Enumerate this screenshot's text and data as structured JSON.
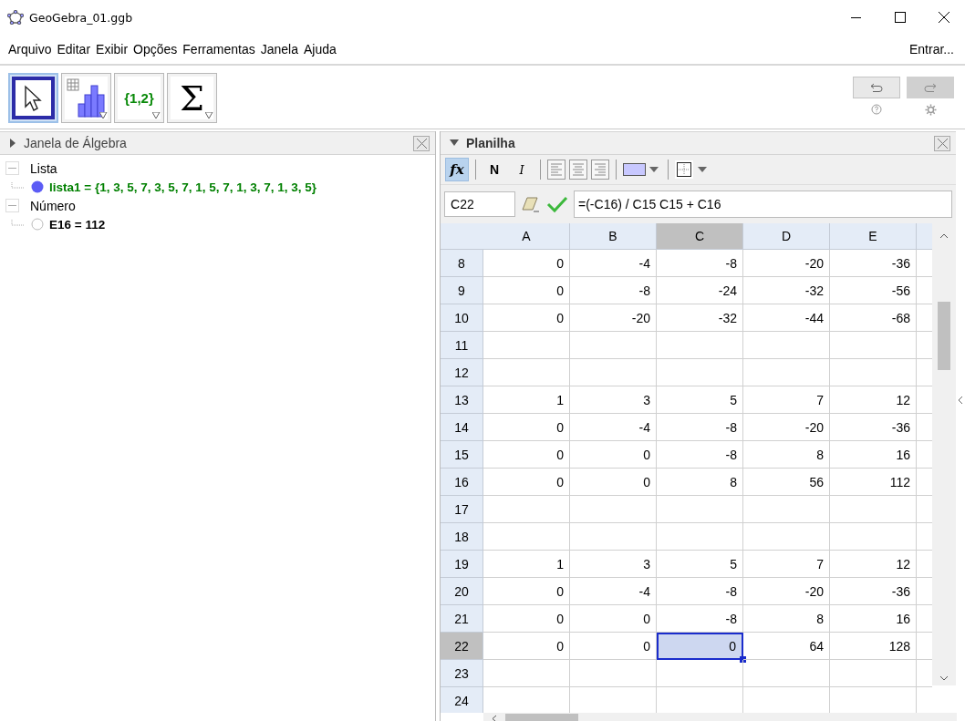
{
  "window": {
    "title": "GeoGebra_01.ggb"
  },
  "menu": {
    "items": [
      "Arquivo",
      "Editar",
      "Exibir",
      "Opções",
      "Ferramentas",
      "Janela",
      "Ajuda"
    ],
    "sign_in": "Entrar..."
  },
  "toolbar": {
    "tools": [
      {
        "kind": "move",
        "selected": true
      },
      {
        "kind": "analysis",
        "selected": false
      },
      {
        "kind": "list",
        "label": "{1,2}",
        "selected": false
      },
      {
        "kind": "sum",
        "label": "Σ",
        "selected": false
      }
    ]
  },
  "algebra": {
    "title": "Janela de Álgebra",
    "expanded": false,
    "groups": [
      {
        "label": "Lista",
        "expanded": true,
        "children": [
          {
            "text": "lista1 = {1, 3, 5, 7, 3, 5, 7, 1, 5, 7, 1, 3, 7, 1, 3, 5}",
            "shown": true,
            "color": "#008000"
          }
        ]
      },
      {
        "label": "Número",
        "expanded": true,
        "children": [
          {
            "text": "E16 = 112",
            "shown": false,
            "color": "#000000"
          }
        ]
      }
    ]
  },
  "spreadsheet": {
    "title": "Planilha",
    "expanded": true,
    "style_bar": {
      "formula_toggle": {
        "label": "fx",
        "selected": true
      },
      "bold": {
        "label": "N",
        "selected": false
      },
      "italic": {
        "label": "I",
        "selected": false
      }
    },
    "formula_bar": {
      "cell": "C22",
      "input": "=(-C16) / C15 C15 + C16"
    },
    "columns": [
      {
        "label": "A",
        "selected": false
      },
      {
        "label": "B",
        "selected": false
      },
      {
        "label": "C",
        "selected": true
      },
      {
        "label": "D",
        "selected": false
      },
      {
        "label": "E",
        "selected": false
      }
    ],
    "rows": [
      {
        "label": "8",
        "selected": false,
        "cells": [
          "0",
          "-4",
          "-8",
          "-20",
          "-36"
        ]
      },
      {
        "label": "9",
        "selected": false,
        "cells": [
          "0",
          "-8",
          "-24",
          "-32",
          "-56"
        ]
      },
      {
        "label": "10",
        "selected": false,
        "cells": [
          "0",
          "-20",
          "-32",
          "-44",
          "-68"
        ]
      },
      {
        "label": "11",
        "selected": false
      },
      {
        "label": "12",
        "selected": false
      },
      {
        "label": "13",
        "selected": false,
        "cells": [
          "1",
          "3",
          "5",
          "7",
          "12"
        ]
      },
      {
        "label": "14",
        "selected": false,
        "cells": [
          "0",
          "-4",
          "-8",
          "-20",
          "-36"
        ]
      },
      {
        "label": "15",
        "selected": false,
        "cells": [
          "0",
          "0",
          "-8",
          "8",
          "16"
        ]
      },
      {
        "label": "16",
        "selected": false,
        "cells": [
          "0",
          "0",
          "8",
          "56",
          "112"
        ]
      },
      {
        "label": "17",
        "selected": false
      },
      {
        "label": "18",
        "selected": false
      },
      {
        "label": "19",
        "selected": false,
        "cells": [
          "1",
          "3",
          "5",
          "7",
          "12"
        ]
      },
      {
        "label": "20",
        "selected": false,
        "cells": [
          "0",
          "-4",
          "-8",
          "-20",
          "-36"
        ]
      },
      {
        "label": "21",
        "selected": false,
        "cells": [
          "0",
          "0",
          "-8",
          "8",
          "16"
        ]
      },
      {
        "label": "22",
        "selected": true,
        "cells": [
          "0",
          "0",
          "0",
          "64",
          "128"
        ]
      },
      {
        "label": "23",
        "selected": false
      },
      {
        "label": "24",
        "selected": false
      }
    ]
  }
}
